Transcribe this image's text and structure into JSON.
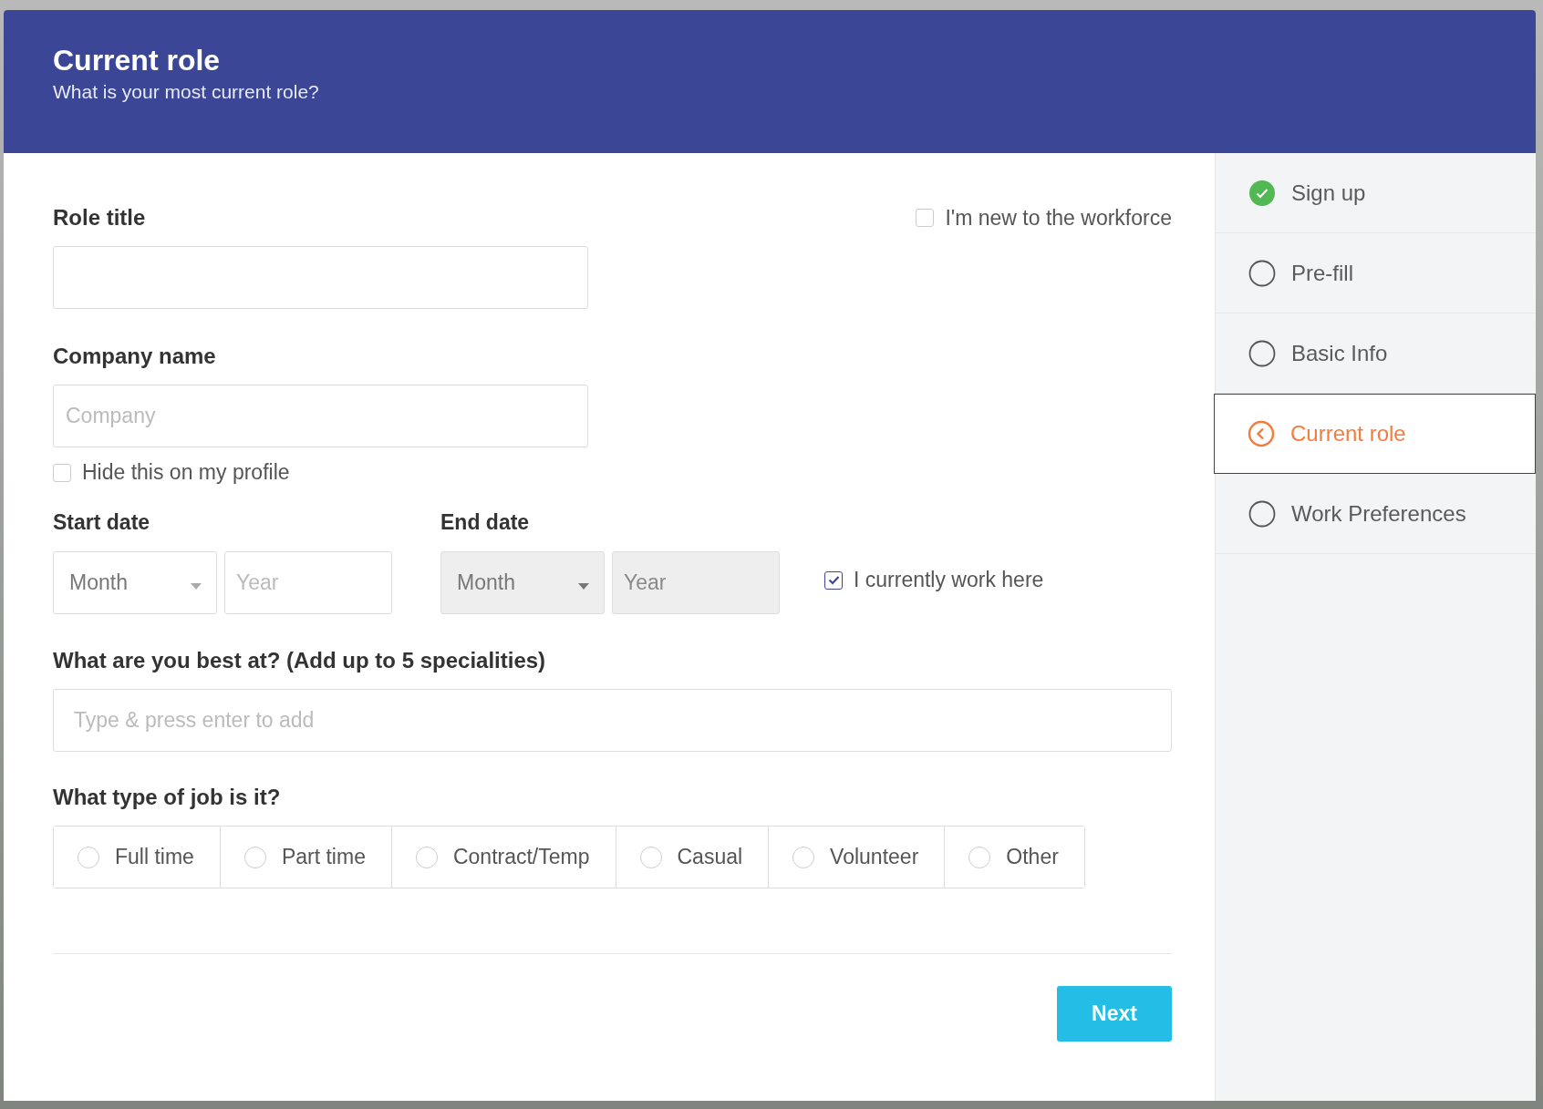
{
  "header": {
    "title": "Current role",
    "subtitle": "What is your most current role?"
  },
  "role_title": {
    "label": "Role title"
  },
  "new_to_workforce": {
    "label": "I'm new to the workforce",
    "checked": false
  },
  "company": {
    "label": "Company name",
    "placeholder": "Company"
  },
  "hide_on_profile": {
    "label": "Hide this on my profile",
    "checked": false
  },
  "start_date": {
    "label": "Start date",
    "month": "Month",
    "year_placeholder": "Year",
    "disabled": false
  },
  "end_date": {
    "label": "End date",
    "month": "Month",
    "year_placeholder": "Year",
    "disabled": true
  },
  "currently_work_here": {
    "label": "I currently work here",
    "checked": true
  },
  "specialities": {
    "label": "What are you best at? (Add up to 5 specialities)",
    "placeholder": "Type & press enter to add"
  },
  "job_type": {
    "label": "What type of job is it?",
    "options": [
      {
        "label": "Full time",
        "selected": false
      },
      {
        "label": "Part time",
        "selected": false
      },
      {
        "label": "Contract/Temp",
        "selected": false
      },
      {
        "label": "Casual",
        "selected": false
      },
      {
        "label": "Volunteer",
        "selected": false
      },
      {
        "label": "Other",
        "selected": false
      }
    ]
  },
  "next_button": "Next",
  "steps": [
    {
      "label": "Sign up",
      "kind": "done",
      "selected": false
    },
    {
      "label": "Pre-fill",
      "kind": "pending",
      "selected": false
    },
    {
      "label": "Basic Info",
      "kind": "pending",
      "selected": false
    },
    {
      "label": "Current role",
      "kind": "current",
      "selected": true
    },
    {
      "label": "Work Preferences",
      "kind": "pending",
      "selected": false
    }
  ]
}
